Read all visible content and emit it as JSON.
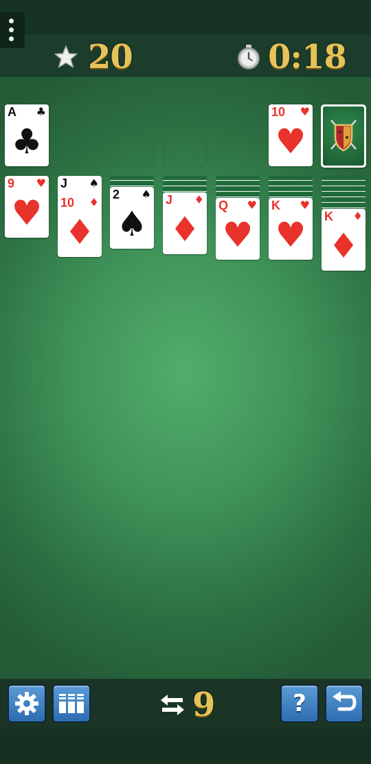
{
  "header": {
    "score": "20",
    "timer": "0:18",
    "menu_icon": "kebab-menu-icon",
    "score_icon": "star-icon",
    "timer_icon": "stopwatch-icon"
  },
  "foundations": [
    {
      "rank": "A",
      "suit": "♣",
      "color": "#111111"
    },
    null,
    null,
    null
  ],
  "waste": {
    "rank": "10",
    "suit": "♥",
    "color": "#e8322b"
  },
  "stock": {
    "icon": "shield-swords-icon"
  },
  "tableau": [
    {
      "hidden": 0,
      "cards": [
        {
          "rank": "9",
          "suit": "♥",
          "color": "#e8322b"
        }
      ]
    },
    {
      "hidden": 0,
      "cards": [
        {
          "rank": "J",
          "suit": "♠",
          "color": "#111111"
        },
        {
          "rank": "10",
          "suit": "♦",
          "color": "#e8322b"
        }
      ]
    },
    {
      "hidden": 2,
      "cards": [
        {
          "rank": "2",
          "suit": "♠",
          "color": "#111111"
        }
      ]
    },
    {
      "hidden": 3,
      "cards": [
        {
          "rank": "J",
          "suit": "♦",
          "color": "#e8322b"
        }
      ]
    },
    {
      "hidden": 4,
      "cards": [
        {
          "rank": "Q",
          "suit": "♥",
          "color": "#e8322b"
        }
      ]
    },
    {
      "hidden": 4,
      "cards": [
        {
          "rank": "K",
          "suit": "♥",
          "color": "#e8322b"
        }
      ]
    },
    {
      "hidden": 6,
      "cards": [
        {
          "rank": "K",
          "suit": "♦",
          "color": "#e8322b"
        }
      ]
    }
  ],
  "footer": {
    "moves": "9",
    "moves_icon": "swap-arrows-icon",
    "settings_icon": "gear-icon",
    "deals_icon": "card-stacks-icon",
    "help_label": "?",
    "undo_icon": "undo-arrow-icon"
  },
  "colors": {
    "felt": "#3f9359",
    "bar": "#1c3d2b",
    "gold": "#e6c35a",
    "button": "#3f82c4",
    "red_suit": "#e8322b"
  }
}
